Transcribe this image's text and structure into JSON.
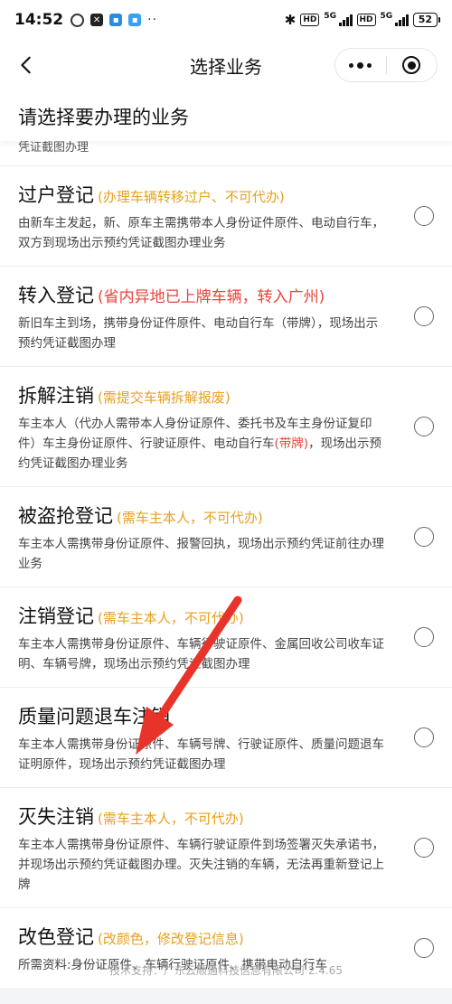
{
  "status_bar": {
    "time": "14:52",
    "network": "5G",
    "hd_label": "HD",
    "battery": "52"
  },
  "nav": {
    "title": "选择业务"
  },
  "heading": "请选择要办理的业务",
  "partial_item_desc": "凭证截图办理",
  "items": [
    {
      "title": "过户登记",
      "note": "(办理车辆转移过户、不可代办)",
      "desc": "由新车主发起，新、原车主需携带本人身份证件原件、电动自行车，双方到现场出示预约凭证截图办理业务"
    },
    {
      "title": "转入登记",
      "note": "(省内异地已上牌车辆，转入广州)",
      "desc": "新旧车主到场，携带身份证件原件、电动自行车（带牌），现场出示预约凭证截图办理"
    },
    {
      "title": "拆解注销",
      "note": "(需提交车辆拆解报废)",
      "desc_before": "车主本人（代办人需带本人身份证原件、委托书及车主身份证复印件）车主身份证原件、行驶证原件、电动自行车",
      "desc_highlight": "(带牌)",
      "desc_after": "，现场出示预约凭证截图办理业务"
    },
    {
      "title": "被盗抢登记",
      "note": "(需车主本人，不可代办)",
      "desc": "车主本人需携带身份证原件、报警回执，现场出示预约凭证前往办理业务"
    },
    {
      "title": "注销登记",
      "note": "(需车主本人，不可代办)",
      "desc": "车主本人需携带身份证原件、车辆行驶证原件、金属回收公司收车证明、车辆号牌，现场出示预约凭证截图办理"
    },
    {
      "title": "质量问题退车注销",
      "note": "",
      "desc": "车主本人需携带身份证原件、车辆号牌、行驶证原件、质量问题退车证明原件，现场出示预约凭证截图办理"
    },
    {
      "title": "灭失注销",
      "note": "(需车主本人，不可代办)",
      "desc": "车主本人需携带身份证原件、车辆行驶证原件到场签署灭失承诺书，并现场出示预约凭证截图办理。灭失注销的车辆，无法再重新登记上牌"
    },
    {
      "title": "改色登记",
      "note": "(改颜色，修改登记信息)",
      "desc": "所需资料:身份证原件、车辆行驶证原件、携带电动自行车"
    }
  ],
  "footer": {
    "text": "技术支持：广东云顺通科技信息有限公司 2.4.65"
  },
  "colors": {
    "note_orange": "#e8a020",
    "note_red": "#e8433a",
    "arrow_red": "#e8332a"
  }
}
